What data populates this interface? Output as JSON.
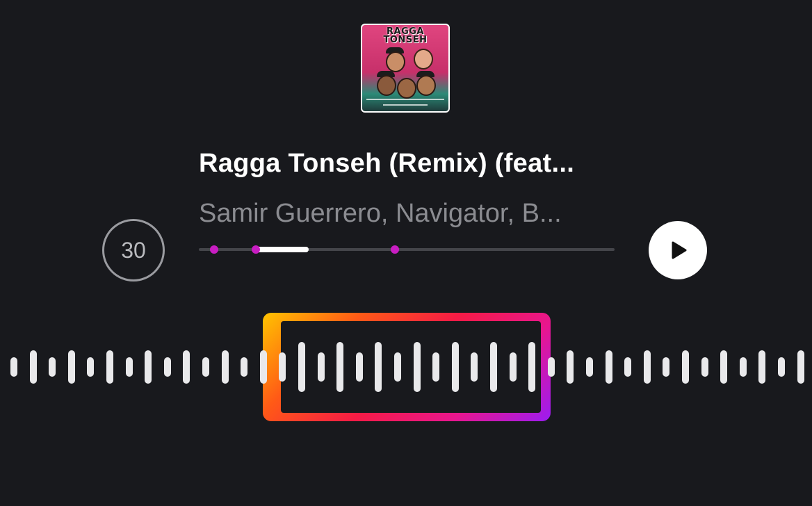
{
  "album_art": {
    "title_line1": "RAGGA",
    "title_line2": "TONSEH"
  },
  "track": {
    "title": "Ragga Tonseh (Remix) (feat...",
    "artist": "Samir Guerrero, Navigator, B..."
  },
  "duration_button": {
    "label": "30",
    "icon": "circle-outline"
  },
  "play_button": {
    "icon": "play-icon"
  },
  "colors": {
    "background": "#18191d",
    "marker": "#c81dc2",
    "frame_gradient": [
      "#ffc400",
      "#ff5a16",
      "#f51b45",
      "#e8168e",
      "#9b1cf2"
    ]
  }
}
